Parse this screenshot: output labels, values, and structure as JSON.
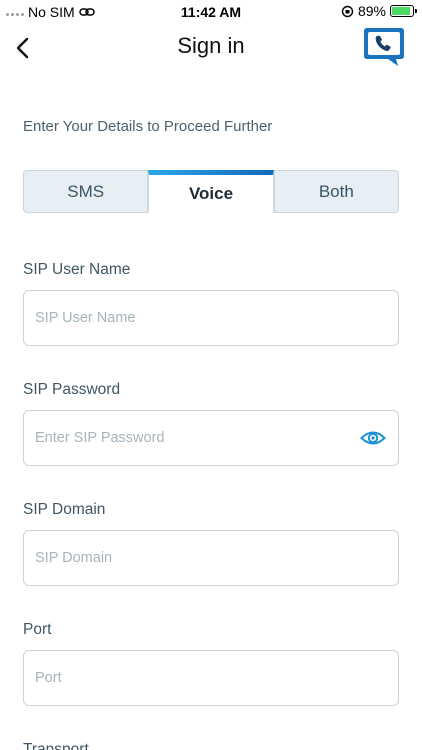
{
  "status_bar": {
    "carrier": "No SIM",
    "time": "11:42 AM",
    "battery_percent": "89%",
    "battery_level": 0.89
  },
  "nav": {
    "title": "Sign in",
    "back_icon": "chevron-left-icon",
    "logo_icon": "phone-chat-logo-icon"
  },
  "subtitle": "Enter Your Details to Proceed Further",
  "tabs": [
    {
      "label": "SMS",
      "active": false
    },
    {
      "label": "Voice",
      "active": true
    },
    {
      "label": "Both",
      "active": false
    }
  ],
  "form": {
    "sip_user": {
      "label": "SIP User Name",
      "placeholder": "SIP User Name",
      "value": ""
    },
    "sip_password": {
      "label": "SIP Password",
      "placeholder": "Enter SIP Password",
      "value": "",
      "toggle_icon": "eye-icon"
    },
    "sip_domain": {
      "label": "SIP Domain",
      "placeholder": "SIP Domain",
      "value": ""
    },
    "port": {
      "label": "Port",
      "placeholder": "Port",
      "value": ""
    },
    "transport": {
      "label": "Transport"
    }
  },
  "colors": {
    "accent": "#1a8fd6",
    "tab_bg": "#e7eff5",
    "label": "#3f5666"
  }
}
